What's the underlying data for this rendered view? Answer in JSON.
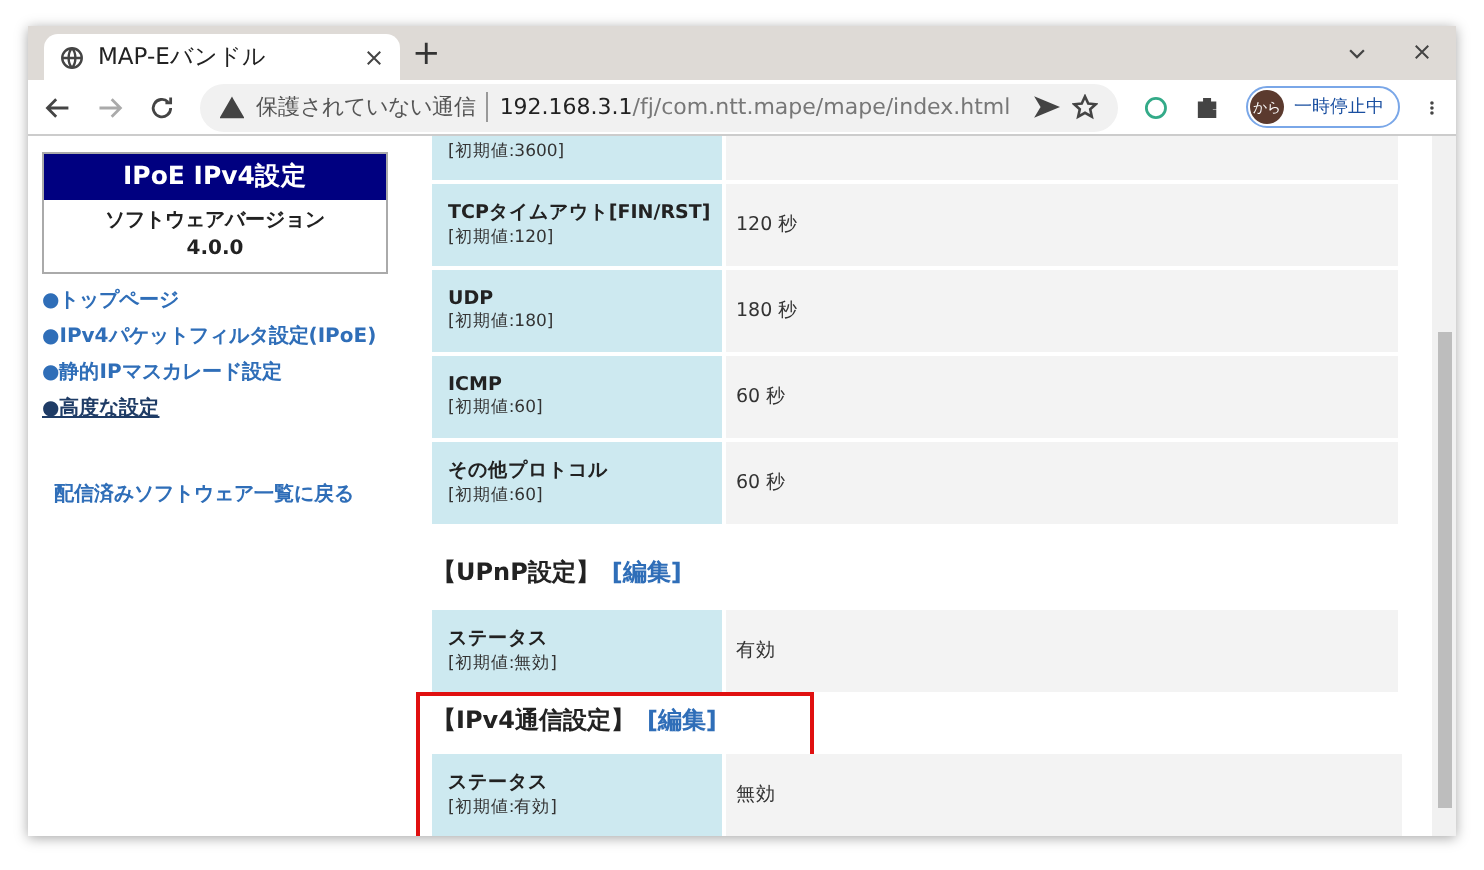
{
  "window": {
    "tab_title": "MAP-Eバンドル",
    "new_tab": "+"
  },
  "toolbar": {
    "security": "保護されていない通信",
    "url_host": "192.168.3.1",
    "url_path": "/fj/com.ntt.mape/mape/index.html",
    "profile_avatar": "から",
    "profile_status": "一時停止中"
  },
  "sidebar": {
    "title": "IPoE IPv4設定",
    "version_label": "ソフトウェアバージョン",
    "version": "4.0.0",
    "links": [
      {
        "label": "●トップページ",
        "selected": false
      },
      {
        "label": "●IPv4パケットフィルタ設定(IPoE)",
        "selected": false
      },
      {
        "label": "●静的IPマスカレード設定",
        "selected": false
      },
      {
        "label": "●高度な設定",
        "selected": true
      }
    ],
    "back_link": "配信済みソフトウェア一覧に戻る"
  },
  "sections": [
    {
      "highlighted": false,
      "rows": [
        {
          "label": "",
          "default": "[初期値:3600]",
          "value": ""
        },
        {
          "label": "TCPタイムアウト[FIN/RST]",
          "default": "[初期値:120]",
          "value": "120 秒"
        },
        {
          "label": "UDP",
          "default": "[初期値:180]",
          "value": "180 秒"
        },
        {
          "label": "ICMP",
          "default": "[初期値:60]",
          "value": "60 秒"
        },
        {
          "label": "その他プロトコル",
          "default": "[初期値:60]",
          "value": "60 秒"
        }
      ]
    },
    {
      "title": "【UPnP設定】",
      "edit": "[編集]",
      "highlighted": false,
      "rows": [
        {
          "label": "ステータス",
          "default": "[初期値:無効]",
          "value": "有効"
        }
      ]
    },
    {
      "title": "【IPv4通信設定】",
      "edit": "[編集]",
      "highlighted": true,
      "rows": [
        {
          "label": "ステータス",
          "default": "[初期値:有効]",
          "value": "無効"
        }
      ]
    }
  ]
}
